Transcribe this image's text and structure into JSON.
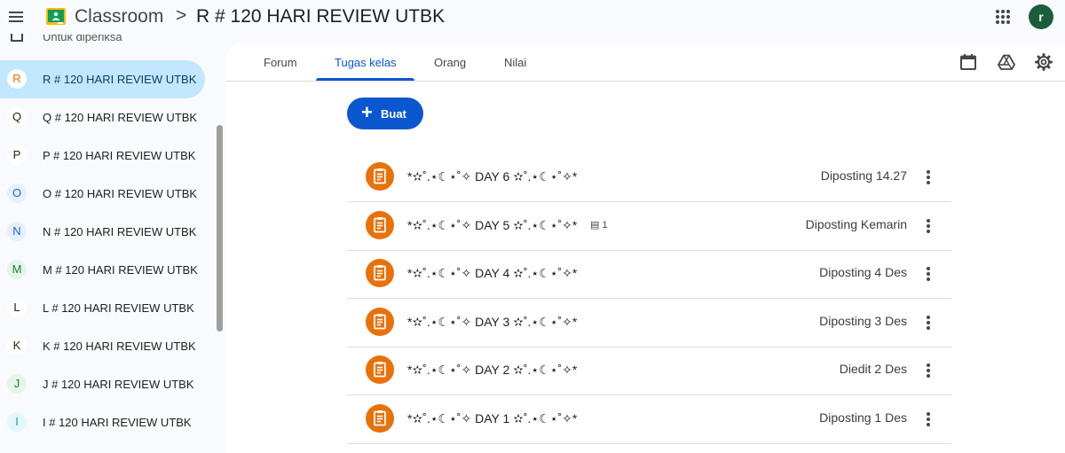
{
  "topbar": {
    "app_title": "Classroom",
    "breadcrumb_separator": ">",
    "class_name": "R # 120 HARI REVIEW UTBK",
    "avatar_letter": "r"
  },
  "sidebar": {
    "cut_item_label": "Untuk diperiksa",
    "items": [
      {
        "letter": "R",
        "label": "R # 120 HARI REVIEW UTBK",
        "active": true,
        "color": "#e8710a",
        "bg": "#ffffff"
      },
      {
        "letter": "Q",
        "label": "Q # 120 HARI REVIEW UTBK",
        "color": "#1f1f1f",
        "bg": "#ffffff"
      },
      {
        "letter": "P",
        "label": "P # 120 HARI REVIEW UTBK",
        "color": "#1f1f1f",
        "bg": "#ffffff"
      },
      {
        "letter": "O",
        "label": "O # 120 HARI REVIEW UTBK",
        "color": "#1967d2",
        "bg": "#e8f0fe"
      },
      {
        "letter": "N",
        "label": "N # 120 HARI REVIEW UTBK",
        "color": "#1967d2",
        "bg": "#e8f0fe"
      },
      {
        "letter": "M",
        "label": "M # 120 HARI REVIEW UTBK",
        "color": "#188038",
        "bg": "#e6f4ea"
      },
      {
        "letter": "L",
        "label": "L # 120 HARI REVIEW UTBK",
        "color": "#1f1f1f",
        "bg": "#ffffff"
      },
      {
        "letter": "K",
        "label": "K # 120 HARI REVIEW UTBK",
        "color": "#1f1f1f",
        "bg": "#ffffff"
      },
      {
        "letter": "J",
        "label": "J # 120 HARI REVIEW UTBK",
        "color": "#188038",
        "bg": "#e6f4ea"
      },
      {
        "letter": "I",
        "label": "I # 120 HARI REVIEW UTBK",
        "color": "#129eaf",
        "bg": "#e4f7fb"
      }
    ]
  },
  "tabs": {
    "forum": "Forum",
    "classwork": "Tugas kelas",
    "people": "Orang",
    "grades": "Nilai",
    "active": "Tugas kelas"
  },
  "toolbar": {
    "create_label": "Buat",
    "icons": [
      "calendar-icon",
      "drive-icon",
      "settings-icon"
    ]
  },
  "tasks": [
    {
      "title": "*✫˚.⋆☾⋆˚✧ DAY 6 ✫˚.⋆☾⋆˚✧*",
      "status": "Diposting 14.27",
      "comments": ""
    },
    {
      "title": "*✫˚.⋆☾⋆˚✧ DAY 5 ✫˚.⋆☾⋆˚✧*",
      "status": "Diposting Kemarin",
      "comments": "1"
    },
    {
      "title": "*✫˚.⋆☾⋆˚✧ DAY 4 ✫˚.⋆☾⋆˚✧*",
      "status": "Diposting 4 Des",
      "comments": ""
    },
    {
      "title": "*✫˚.⋆☾⋆˚✧ DAY 3 ✫˚.⋆☾⋆˚✧*",
      "status": "Diposting 3 Des",
      "comments": ""
    },
    {
      "title": "*✫˚.⋆☾⋆˚✧ DAY 2 ✫˚.⋆☾⋆˚✧*",
      "status": "Diedit 2 Des",
      "comments": ""
    },
    {
      "title": "*✫˚.⋆☾⋆˚✧ DAY 1 ✫˚.⋆☾⋆˚✧*",
      "status": "Diposting 1 Des",
      "comments": ""
    }
  ],
  "colors": {
    "accent": "#0b57d0",
    "task_icon": "#e8710a",
    "active_sidebar": "#c2e7ff"
  }
}
